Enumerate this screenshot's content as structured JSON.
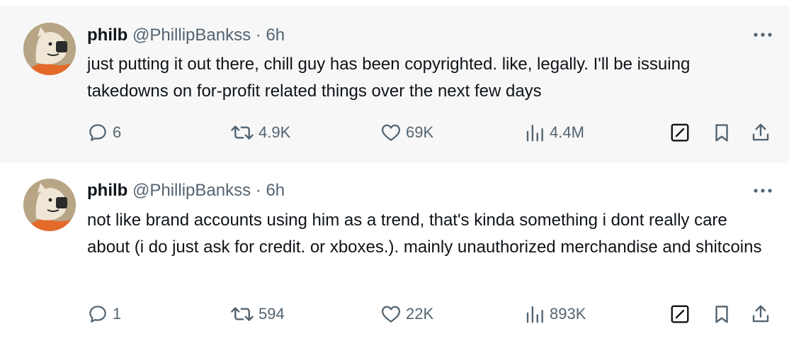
{
  "tweets": [
    {
      "name": "philb",
      "handle": "@PhillipBankss",
      "separator": "·",
      "time": "6h",
      "text": "just putting it out there, chill guy has been copyrighted. like, legally. I'll be issuing takedowns on for-profit related things over the next few days",
      "replies": "6",
      "retweets": "4.9K",
      "likes": "69K",
      "views": "4.4M"
    },
    {
      "name": "philb",
      "handle": "@PhillipBankss",
      "separator": "·",
      "time": "6h",
      "text": "not like brand accounts using him as a trend, that's kinda something i dont really care about (i do just ask for credit. or xboxes.). mainly unauthorized merchandise and shitcoins",
      "replies": "1",
      "retweets": "594",
      "likes": "22K",
      "views": "893K"
    }
  ],
  "colors": {
    "text": "#0f1419",
    "muted": "#536471",
    "first_bg": "#f7f7f7",
    "thread_line": "#cfd9de"
  },
  "icons": [
    "avatar",
    "more-icon",
    "reply-icon",
    "retweet-icon",
    "like-icon",
    "views-icon",
    "edit-icon",
    "bookmark-icon",
    "share-icon"
  ]
}
